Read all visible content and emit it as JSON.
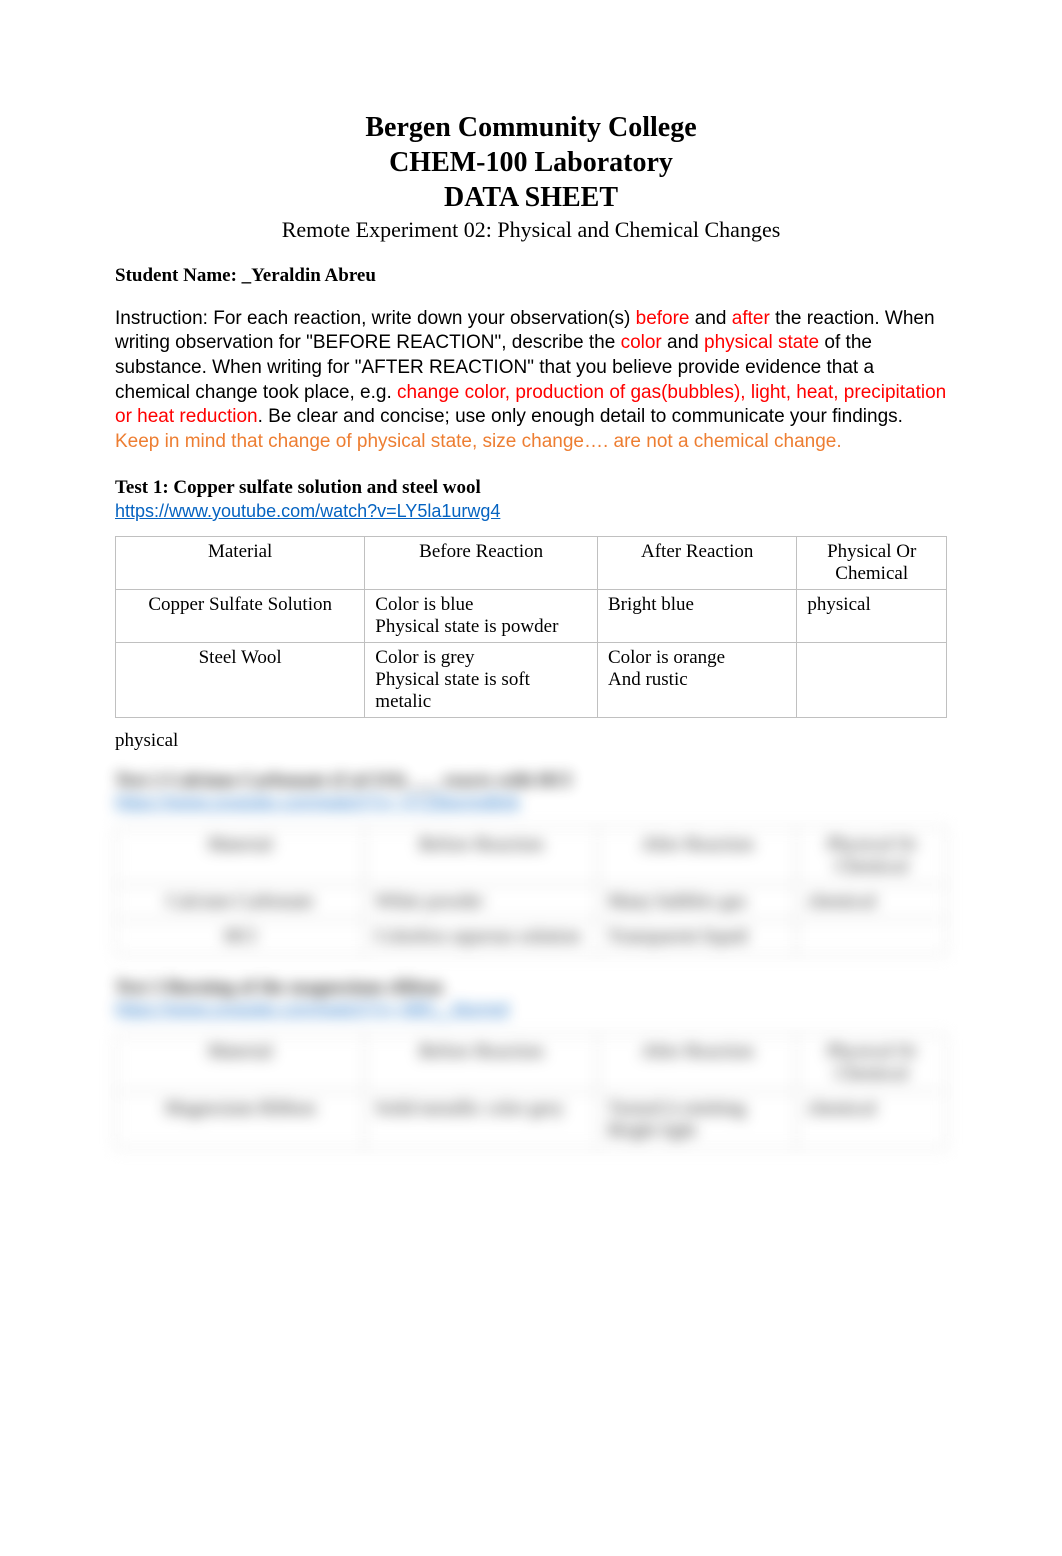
{
  "header": {
    "line1": "Bergen Community College",
    "line2": "CHEM-100 Laboratory",
    "line3": "DATA SHEET",
    "subtitle": "Remote Experiment 02: Physical and Chemical Changes"
  },
  "student": {
    "label": "Student Name: ",
    "value": "_Yeraldin Abreu"
  },
  "instructions": {
    "p1a": "Instruction: For each reaction, write down your observation(s) ",
    "before": "before",
    "p1b": " and ",
    "after": "after",
    "p1c": " the reaction. When writing observation for \"BEFORE REACTION\", describe the ",
    "color_word": "color",
    "p1d": " and ",
    "phys_state": "physical state",
    "p1e": " of the substance. When writing for \"AFTER REACTION\" that you believe provide evidence that a chemical change took place, e.g. ",
    "evidence": "change color, production of gas(bubbles), light, heat, precipitation or heat reduction",
    "p1f": ".  Be clear and concise; use only enough detail to communicate your findings. ",
    "keepmind": "Keep in mind that change of physical state, size change…. are not a chemical change."
  },
  "test1": {
    "title": "Test 1: Copper sulfate solution and steel wool",
    "link": "https://www.youtube.com/watch?v=LY5la1urwg4",
    "headers": {
      "material": "Material",
      "before": "Before Reaction",
      "after": "After Reaction",
      "poc": "Physical Or Chemical"
    },
    "rows": [
      {
        "material": "Copper Sulfate Solution",
        "before": "Color is blue\nPhysical state is powder",
        "after": "Bright blue",
        "poc": "physical"
      },
      {
        "material": "Steel Wool",
        "before": "Color is grey\nPhysical state is soft metalic",
        "after": "Color is orange\nAnd rustic",
        "poc": ""
      }
    ],
    "outside_value": "physical"
  },
  "obscured": {
    "test2_title": "Test 2 Calcium Carbonate (CaCO3) ___ reacts with HCl",
    "test2_link": "https://www.youtube.com/watch?v= XYZblurredlink",
    "headers": {
      "material": "Material",
      "before": "Before Reaction",
      "after": "After Reaction",
      "poc": "Physical Or Chemical"
    },
    "t2rows": [
      {
        "material": "Calcium Carbonate",
        "before": "White powder",
        "after": "Many bubbles gas",
        "poc": "chemical"
      },
      {
        "material": "HCl",
        "before": "Colorless aqueous solution",
        "after": "Transparent liquid",
        "poc": ""
      }
    ],
    "test3_title": "Test 3 Burning of the magnesium ribbon",
    "test3_link": "https://www.youtube.com/watch?v= ABC_ blurred",
    "t3rows": [
      {
        "material": "Magnesium Ribbon",
        "before": "Solid metallic color grey",
        "after": "Turned it emitting Bright light",
        "poc": "chemical"
      }
    ]
  }
}
